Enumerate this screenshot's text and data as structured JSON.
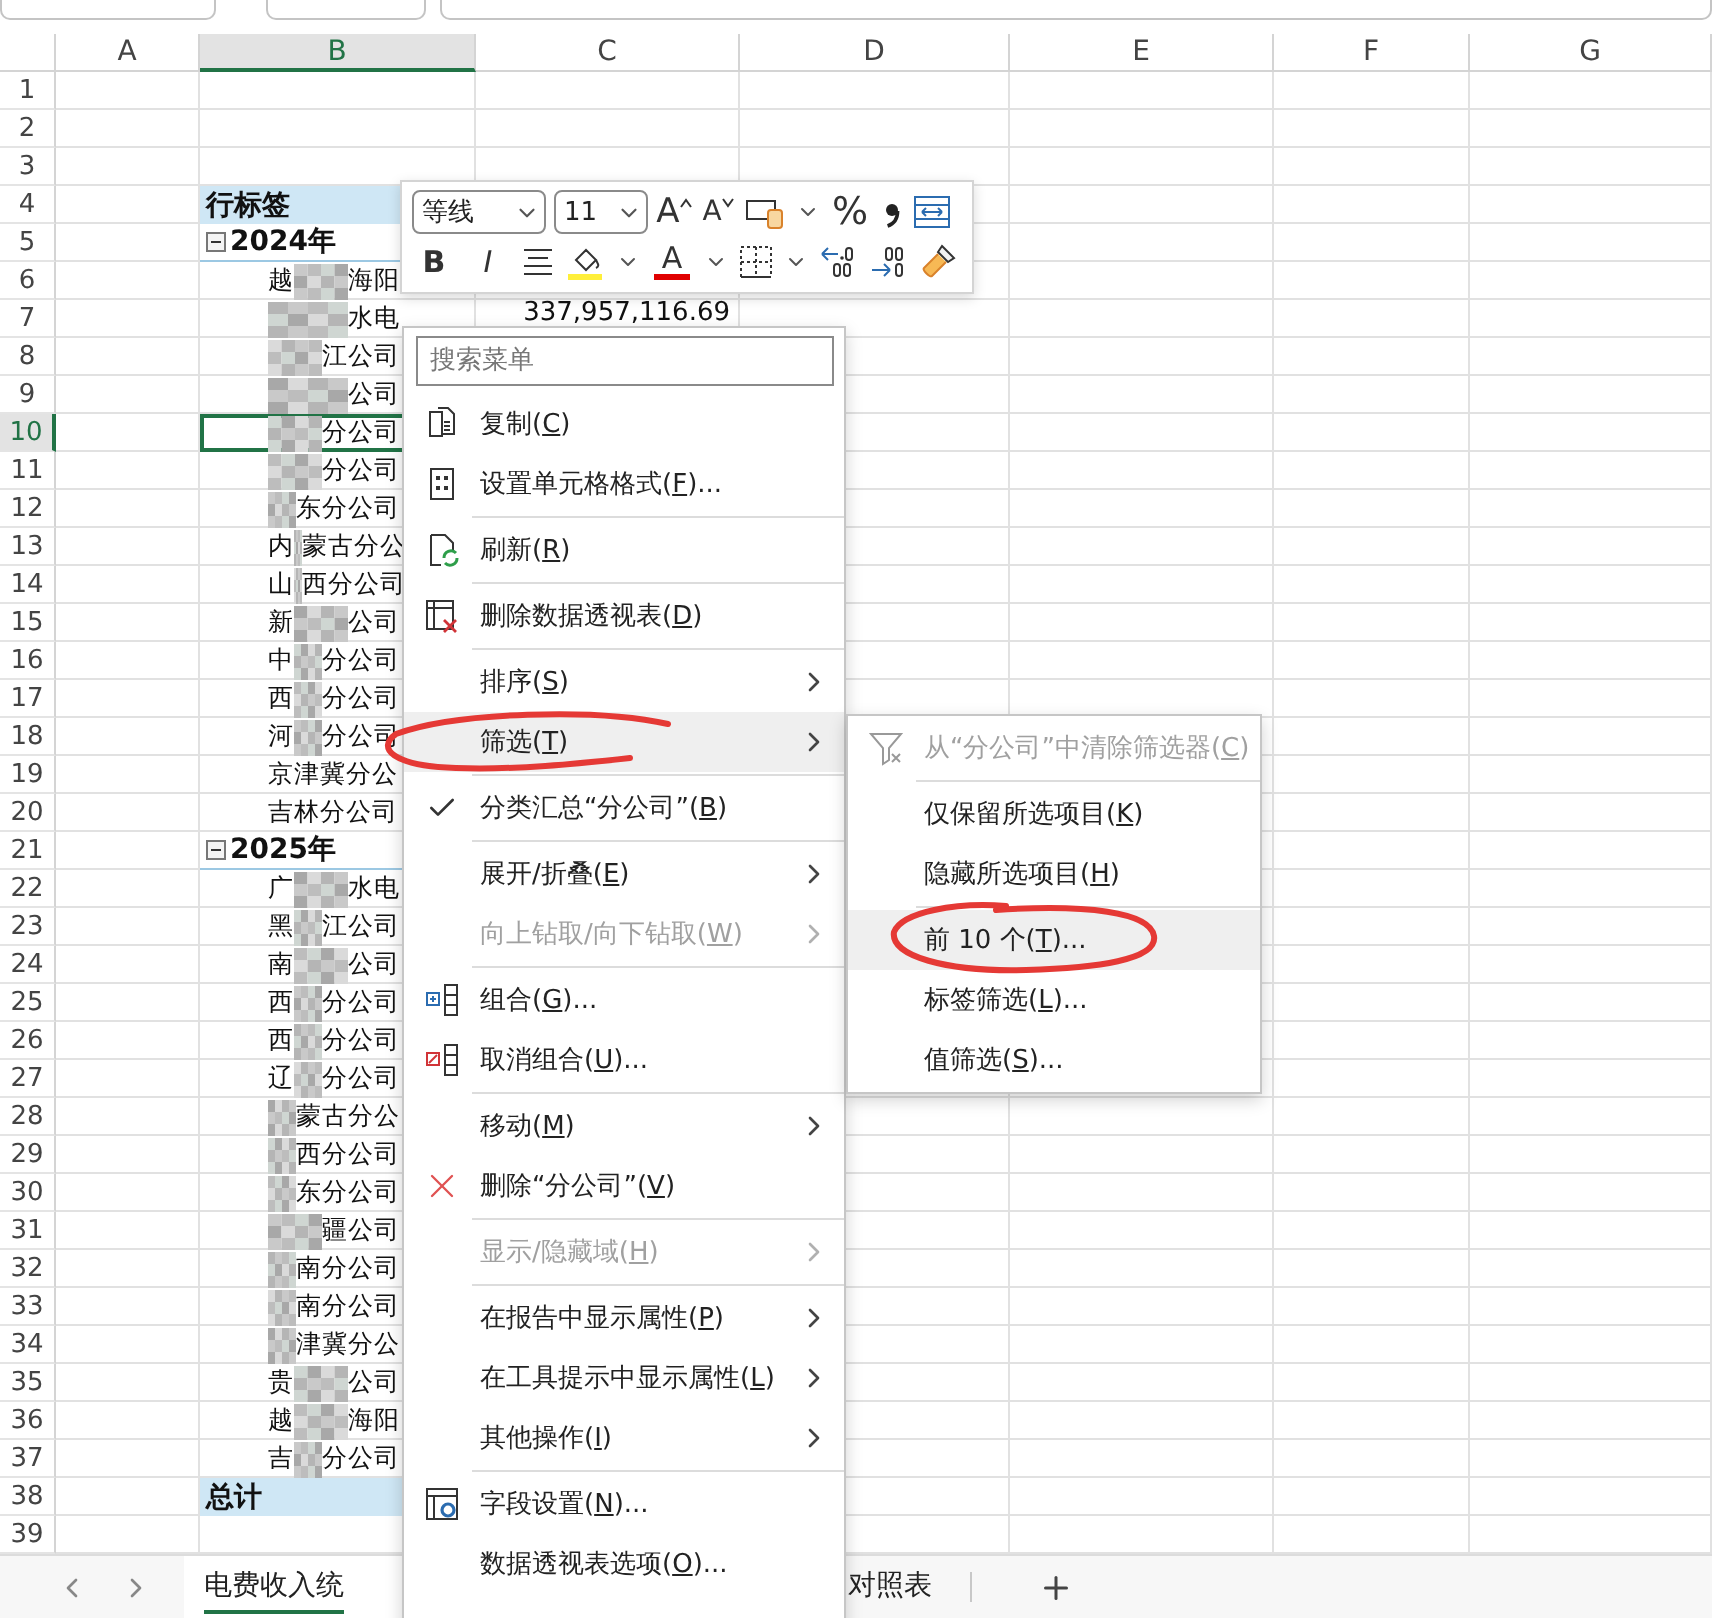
{
  "columns": [
    {
      "label": "A",
      "selected": false
    },
    {
      "label": "B",
      "selected": true
    },
    {
      "label": "C",
      "selected": false
    },
    {
      "label": "D",
      "selected": false
    },
    {
      "label": "E",
      "selected": false
    },
    {
      "label": "F",
      "selected": false
    },
    {
      "label": "G",
      "selected": false
    }
  ],
  "row_headers": [
    {
      "label": "1",
      "selected": false
    },
    {
      "label": "2",
      "selected": false
    },
    {
      "label": "3",
      "selected": false
    },
    {
      "label": "4",
      "selected": false
    },
    {
      "label": "5",
      "selected": false
    },
    {
      "label": "6",
      "selected": false
    },
    {
      "label": "7",
      "selected": false
    },
    {
      "label": "8",
      "selected": false
    },
    {
      "label": "9",
      "selected": false
    },
    {
      "label": "10",
      "selected": true
    },
    {
      "label": "11",
      "selected": false
    },
    {
      "label": "12",
      "selected": false
    },
    {
      "label": "13",
      "selected": false
    },
    {
      "label": "14",
      "selected": false
    },
    {
      "label": "15",
      "selected": false
    },
    {
      "label": "16",
      "selected": false
    },
    {
      "label": "17",
      "selected": false
    },
    {
      "label": "18",
      "selected": false
    },
    {
      "label": "19",
      "selected": false
    },
    {
      "label": "20",
      "selected": false
    },
    {
      "label": "21",
      "selected": false
    },
    {
      "label": "22",
      "selected": false
    },
    {
      "label": "23",
      "selected": false
    },
    {
      "label": "24",
      "selected": false
    },
    {
      "label": "25",
      "selected": false
    },
    {
      "label": "26",
      "selected": false
    },
    {
      "label": "27",
      "selected": false
    },
    {
      "label": "28",
      "selected": false
    },
    {
      "label": "29",
      "selected": false
    },
    {
      "label": "30",
      "selected": false
    },
    {
      "label": "31",
      "selected": false
    },
    {
      "label": "32",
      "selected": false
    },
    {
      "label": "33",
      "selected": false
    },
    {
      "label": "34",
      "selected": false
    },
    {
      "label": "35",
      "selected": false
    },
    {
      "label": "36",
      "selected": false
    },
    {
      "label": "37",
      "selected": false
    },
    {
      "label": "38",
      "selected": false
    },
    {
      "label": "39",
      "selected": false
    }
  ],
  "pivot": {
    "header": "行标签",
    "total": "总计",
    "groups": [
      {
        "label": "2024年",
        "expanded": true,
        "items": [
          {
            "lead": "越",
            "text": "海阳",
            "blurred": true,
            "selected": false
          },
          {
            "text": "水电",
            "value": "337,957,116.69",
            "blurred": true,
            "selected": false
          },
          {
            "text": "江公司",
            "blurred": true,
            "selected": false
          },
          {
            "text": "公司",
            "blurred": true,
            "selected": false
          },
          {
            "text": "分公司",
            "blurred": true,
            "selected": true
          },
          {
            "text": "分公司",
            "blurred": true,
            "selected": false
          },
          {
            "text": "东分公司",
            "blurred": true,
            "selected": false
          },
          {
            "lead": "内",
            "text": "蒙古分公",
            "blurred": true,
            "selected": false
          },
          {
            "lead": "山",
            "text": "西分公司",
            "blurred": true,
            "selected": false
          },
          {
            "lead": "新",
            "text": "公司",
            "blurred": true,
            "selected": false
          },
          {
            "lead": "中",
            "text": "分公司",
            "blurred": true,
            "selected": false
          },
          {
            "lead": "西",
            "text": "分公司",
            "blurred": true,
            "selected": false
          },
          {
            "lead": "河",
            "text": "分公司",
            "blurred": true,
            "selected": false
          },
          {
            "text": "京津冀分公",
            "blurred": false,
            "selected": false
          },
          {
            "text": "吉林分公司",
            "blurred": false,
            "selected": false
          }
        ]
      },
      {
        "label": "2025年",
        "expanded": true,
        "items": [
          {
            "lead": "广",
            "text": "水电",
            "blurred": true,
            "selected": false
          },
          {
            "lead": "黑",
            "text": "江公司",
            "blurred": true,
            "selected": false
          },
          {
            "lead": "南",
            "text": "公司",
            "blurred": true,
            "selected": false
          },
          {
            "lead": "西",
            "text": "分公司",
            "blurred": true,
            "selected": false
          },
          {
            "lead": "西",
            "text": "分公司",
            "blurred": true,
            "selected": false
          },
          {
            "lead": "辽",
            "text": "分公司",
            "blurred": true,
            "selected": false
          },
          {
            "text": "蒙古分公",
            "blurred": true,
            "selected": false
          },
          {
            "text": "西分公司",
            "blurred": true,
            "selected": false
          },
          {
            "text": "东分公司",
            "blurred": true,
            "selected": false
          },
          {
            "text": "疆公司",
            "blurred": true,
            "selected": false
          },
          {
            "text": "南分公司",
            "blurred": true,
            "selected": false
          },
          {
            "text": "南分公司",
            "blurred": true,
            "selected": false
          },
          {
            "text": "津冀分公",
            "blurred": true,
            "selected": false
          },
          {
            "lead": "贵",
            "text": "公司",
            "blurred": true,
            "selected": false
          },
          {
            "lead": "越",
            "text": "海阳",
            "blurred": true,
            "selected": false
          },
          {
            "lead": "吉",
            "text": "分公司",
            "blurred": true,
            "selected": false
          }
        ]
      }
    ]
  },
  "mini_toolbar": {
    "font": "等线",
    "size": "11",
    "grow": "A",
    "shrink": "A",
    "percent": "%",
    "bold": "B",
    "italic": "I",
    "font_color": "A"
  },
  "context_menu": {
    "search": {
      "placeholder": "搜索菜单"
    },
    "groups": [
      [
        {
          "before": "复制(",
          "key": "C",
          "after": ")",
          "kind": "copy",
          "submenu": false,
          "disabled": false,
          "checked": false,
          "highlighted": false
        },
        {
          "before": "设置单元格格式(",
          "key": "F",
          "after": ")...",
          "kind": "format",
          "submenu": false,
          "disabled": false,
          "checked": false,
          "highlighted": false
        }
      ],
      [
        {
          "before": "刷新(",
          "key": "R",
          "after": ")",
          "kind": "refresh",
          "submenu": false,
          "disabled": false,
          "checked": false,
          "highlighted": false
        }
      ],
      [
        {
          "before": "删除数据透视表(",
          "key": "D",
          "after": ")",
          "kind": "delete-table",
          "submenu": false,
          "disabled": false,
          "checked": false,
          "highlighted": false
        }
      ],
      [
        {
          "before": "排序(",
          "key": "S",
          "after": ")",
          "submenu": true,
          "disabled": false,
          "checked": false,
          "highlighted": false
        },
        {
          "before": "筛选(",
          "key": "T",
          "after": ")",
          "submenu": true,
          "disabled": false,
          "checked": false,
          "highlighted": true
        }
      ],
      [
        {
          "before": "分类汇总“分公司”(",
          "key": "B",
          "after": ")",
          "submenu": false,
          "disabled": false,
          "checked": true,
          "highlighted": false
        }
      ],
      [
        {
          "before": "展开/折叠(",
          "key": "E",
          "after": ")",
          "submenu": true,
          "disabled": false,
          "checked": false,
          "highlighted": false
        },
        {
          "before": "向上钻取/向下钻取(",
          "key": "W",
          "after": ")",
          "submenu": true,
          "disabled": true,
          "checked": false,
          "highlighted": false
        }
      ],
      [
        {
          "before": "组合(",
          "key": "G",
          "after": ")...",
          "kind": "group",
          "submenu": false,
          "disabled": false,
          "checked": false,
          "highlighted": false
        },
        {
          "before": "取消组合(",
          "key": "U",
          "after": ")...",
          "kind": "ungroup",
          "submenu": false,
          "disabled": false,
          "checked": false,
          "highlighted": false
        }
      ],
      [
        {
          "before": "移动(",
          "key": "M",
          "after": ")",
          "submenu": true,
          "disabled": false,
          "checked": false,
          "highlighted": false
        },
        {
          "before": "删除“分公司”(",
          "key": "V",
          "after": ")",
          "kind": "remove",
          "submenu": false,
          "disabled": false,
          "checked": false,
          "highlighted": false
        }
      ],
      [
        {
          "before": "显示/隐藏域(",
          "key": "H",
          "after": ")",
          "submenu": true,
          "disabled": true,
          "checked": false,
          "highlighted": false
        }
      ],
      [
        {
          "before": "在报告中显示属性(",
          "key": "P",
          "after": ")",
          "submenu": true,
          "disabled": false,
          "checked": false,
          "highlighted": false
        },
        {
          "before": "在工具提示中显示属性(",
          "key": "L",
          "after": ")",
          "submenu": true,
          "disabled": false,
          "checked": false,
          "highlighted": false
        },
        {
          "before": "其他操作(",
          "key": "I",
          "after": ")",
          "submenu": true,
          "disabled": false,
          "checked": false,
          "highlighted": false
        }
      ],
      [
        {
          "before": "字段设置(",
          "key": "N",
          "after": ")...",
          "kind": "field-settings",
          "submenu": false,
          "disabled": false,
          "checked": false,
          "highlighted": false
        },
        {
          "before": "数据透视表选项(",
          "key": "O",
          "after": ")...",
          "submenu": false,
          "disabled": false,
          "checked": false,
          "highlighted": false
        }
      ]
    ]
  },
  "filter_submenu": {
    "groups": [
      [
        {
          "before": "从“分公司”中清除筛选器(",
          "key": "C",
          "after": ")",
          "kind": "clear-filter",
          "disabled": true,
          "highlighted": false
        }
      ],
      [
        {
          "before": "仅保留所选项目(",
          "key": "K",
          "after": ")",
          "disabled": false,
          "highlighted": false
        },
        {
          "before": "隐藏所选项目(",
          "key": "H",
          "after": ")",
          "disabled": false,
          "highlighted": false
        }
      ],
      [
        {
          "before": "前 10 个(",
          "key": "T",
          "after": ")...",
          "disabled": false,
          "highlighted": true
        },
        {
          "before": "标签筛选(",
          "key": "L",
          "after": ")...",
          "disabled": false,
          "highlighted": false
        },
        {
          "before": "值筛选(",
          "key": "S",
          "after": ")...",
          "disabled": false,
          "highlighted": false
        }
      ]
    ]
  },
  "sheet_tabs": [
    {
      "label": "电费收入统",
      "selected": true
    },
    {
      "label": "对照表",
      "selected": false
    }
  ]
}
